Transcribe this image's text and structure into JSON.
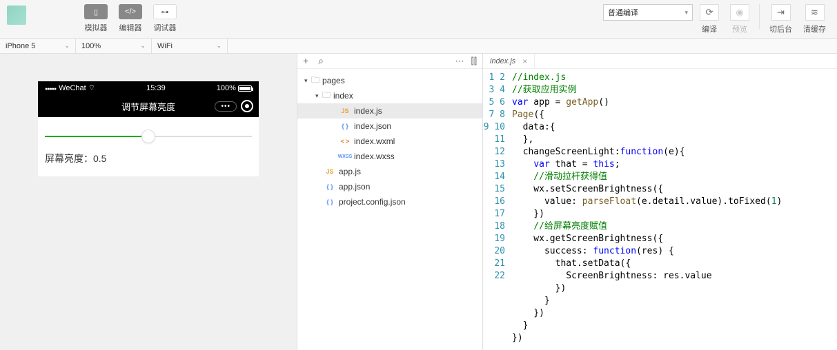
{
  "toolbar": {
    "simulator": "模拟器",
    "editor": "编辑器",
    "debugger": "调试器",
    "compile_mode": "普通编译",
    "compile": "编译",
    "preview": "预览",
    "background": "切后台",
    "clear_cache": "清缓存"
  },
  "subbar": {
    "device": "iPhone 5",
    "zoom": "100%",
    "network": "WiFi"
  },
  "simulator": {
    "carrier": "WeChat",
    "time": "15:39",
    "battery": "100%",
    "title": "调节屏幕亮度",
    "brightness_text": "屏幕亮度：0.5"
  },
  "tree": {
    "pages": "pages",
    "index_folder": "index",
    "files": {
      "indexjs": "index.js",
      "indexjson": "index.json",
      "indexwxml": "index.wxml",
      "indexwxss": "index.wxss",
      "appjs": "app.js",
      "appjson": "app.json",
      "projconf": "project.config.json"
    }
  },
  "tab": {
    "name": "index.js"
  },
  "code": {
    "lines": [
      "1",
      "2",
      "3",
      "4",
      "5",
      "6",
      "7",
      "8",
      "9",
      "10",
      "11",
      "12",
      "13",
      "14",
      "15",
      "16",
      "17",
      "18",
      "19",
      "20",
      "21",
      "22"
    ],
    "l1": "//index.js",
    "l2": "//获取应用实例",
    "l3a": "var",
    "l3b": " app = ",
    "l3c": "getApp",
    "l3d": "()",
    "l4a": "Page",
    "l4b": "({",
    "l5": "  data:{",
    "l6": "  },",
    "l7a": "  changeScreenLight:",
    "l7b": "function",
    "l7c": "(e){",
    "l8a": "    ",
    "l8b": "var",
    "l8c": " that = ",
    "l8d": "this",
    "l8e": ";",
    "l9": "    //滑动拉杆获得值",
    "l10": "    wx.setScreenBrightness({",
    "l11a": "      value: ",
    "l11b": "parseFloat",
    "l11c": "(e.detail.value).toFixed(",
    "l11d": "1",
    "l11e": ")",
    "l12": "    })",
    "l13": "    //给屏幕亮度赋值",
    "l14": "    wx.getScreenBrightness({",
    "l15a": "      success: ",
    "l15b": "function",
    "l15c": "(res) {",
    "l16": "        that.setData({",
    "l17": "          ScreenBrightness: res.value",
    "l18": "        })",
    "l19": "      }",
    "l20": "    })",
    "l21": "  }",
    "l22": "})"
  }
}
